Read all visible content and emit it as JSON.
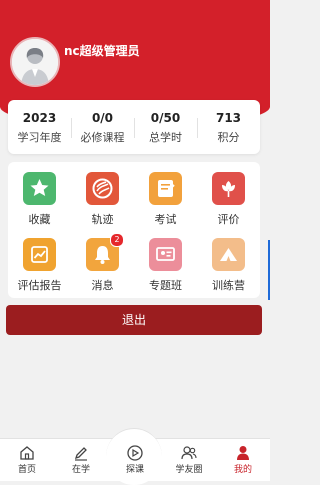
{
  "user": {
    "name": "nc超级管理员"
  },
  "stats": [
    {
      "value": "2023",
      "label": "学习年度"
    },
    {
      "value": "0/0",
      "label": "必修课程"
    },
    {
      "value": "0/50",
      "label": "总学时"
    },
    {
      "value": "713",
      "label": "积分"
    }
  ],
  "menu": [
    {
      "label": "收藏",
      "icon": "star-icon",
      "color": "#4db76e"
    },
    {
      "label": "轨迹",
      "icon": "track-icon",
      "color": "#e2573a"
    },
    {
      "label": "考试",
      "icon": "exam-icon",
      "color": "#f2a13c"
    },
    {
      "label": "评价",
      "icon": "flower-icon",
      "color": "#e0504a"
    },
    {
      "label": "评估报告",
      "icon": "report-icon",
      "color": "#f0a32f"
    },
    {
      "label": "消息",
      "icon": "bell-icon",
      "color": "#f2a53d",
      "badge": "2"
    },
    {
      "label": "专题班",
      "icon": "class-icon",
      "color": "#ec8e9a"
    },
    {
      "label": "训练营",
      "icon": "camp-icon",
      "color": "#f3bd8a"
    }
  ],
  "logout_label": "退出",
  "tabs": [
    {
      "label": "首页",
      "icon": "home-icon"
    },
    {
      "label": "在学",
      "icon": "pen-icon"
    },
    {
      "label": "探课",
      "icon": "explore-icon"
    },
    {
      "label": "学友圈",
      "icon": "friends-icon"
    },
    {
      "label": "我的",
      "icon": "person-icon"
    }
  ],
  "colors": {
    "primary": "#d3202a",
    "logout": "#9b1d1f",
    "active_tab": "#c8242b"
  }
}
